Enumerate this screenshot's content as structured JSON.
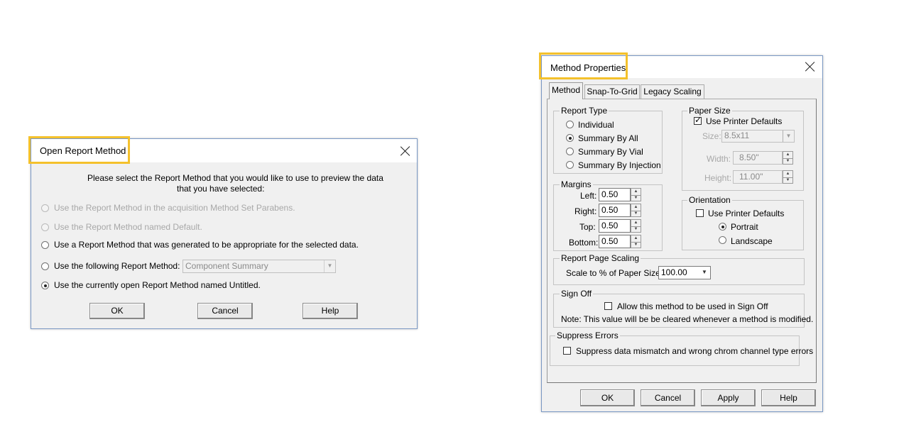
{
  "dialog1": {
    "title": "Open Report Method",
    "prompt_line1": "Please select the Report Method that you would like to use to preview the data",
    "prompt_line2": "that you have selected:",
    "options": [
      "Use the Report Method in the acquisition Method Set Parabens.",
      "Use the Report Method named Default.",
      "Use a Report Method that was generated to be appropriate for the selected data.",
      "Use the following Report Method:",
      "Use the currently open Report Method named Untitled."
    ],
    "report_method_value": "Component Summary",
    "ok_label": "OK",
    "cancel_label": "Cancel",
    "help_label": "Help"
  },
  "dialog2": {
    "title": "Method Properties",
    "tabs": [
      "Method",
      "Snap-To-Grid",
      "Legacy Scaling"
    ],
    "report_type": {
      "label": "Report Type",
      "options": [
        "Individual",
        "Summary By All",
        "Summary By Vial",
        "Summary By Injection"
      ]
    },
    "paper_size": {
      "label": "Paper Size",
      "use_printer_defaults": "Use Printer Defaults",
      "size_label": "Size:",
      "size_value": "8.5x11",
      "width_label": "Width:",
      "width_value": "8.50\"",
      "height_label": "Height:",
      "height_value": "11.00\""
    },
    "margins": {
      "label": "Margins",
      "left_label": "Left:",
      "left_value": "0.50",
      "right_label": "Right:",
      "right_value": "0.50",
      "top_label": "Top:",
      "top_value": "0.50",
      "bottom_label": "Bottom:",
      "bottom_value": "0.50"
    },
    "orientation": {
      "label": "Orientation",
      "use_printer_defaults": "Use Printer Defaults",
      "portrait": "Portrait",
      "landscape": "Landscape"
    },
    "scaling": {
      "label": "Report Page Scaling",
      "scale_label": "Scale to % of Paper Size:",
      "scale_value": "100.00"
    },
    "sign_off": {
      "label": "Sign Off",
      "checkbox_label": "Allow this method to be used in Sign Off",
      "note": "Note: This value will be be cleared whenever a method is modified."
    },
    "suppress": {
      "label": "Suppress Errors",
      "checkbox_label": "Suppress data mismatch and wrong chrom channel type errors"
    },
    "ok_label": "OK",
    "cancel_label": "Cancel",
    "apply_label": "Apply",
    "help_label": "Help"
  },
  "colors": {
    "highlight": "#f4c12c",
    "dialog_border": "#7a98c4",
    "dialog_bg": "#f0f0f0"
  }
}
